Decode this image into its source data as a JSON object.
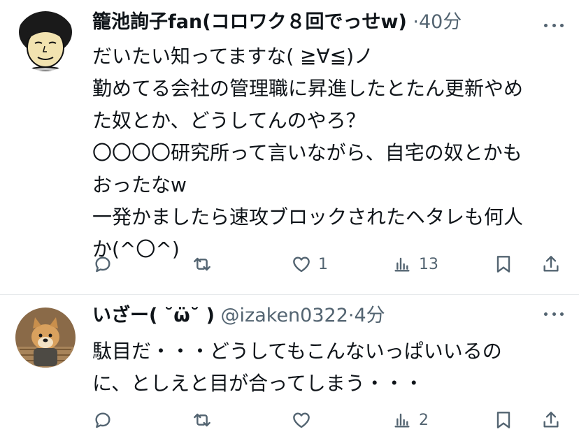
{
  "tweets": [
    {
      "author_name": "籠池詢子fan(コロワク８回でっせw)",
      "handle": "",
      "separator": "·",
      "time": "40分",
      "lines": [
        "だいたい知ってますな( ≧∀≦)ノ",
        "勤めてる会社の管理職に昇進したとたん更新やめ",
        "た奴とか、どうしてんのやろ？",
        "〇〇〇〇研究所って言いながら、自宅の奴とかも",
        "おったなw",
        "一発かましたら速攻ブロックされたヘタレも何人",
        "か(^〇^)"
      ],
      "counts": {
        "reply": "",
        "retweet": "",
        "like": "1",
        "views": "13"
      }
    },
    {
      "author_name": "いざー( ˘ω̈˘ )",
      "handle": "@izaken0322",
      "separator": "·",
      "time": "4分",
      "lines": [
        "駄目だ・・・どうしてもこんないっぱいいるの",
        "に、としえと目が合ってしまう・・・"
      ],
      "counts": {
        "reply": "",
        "retweet": "",
        "like": "",
        "views": "2"
      }
    }
  ],
  "icons": [
    "reply-icon",
    "retweet-icon",
    "like-icon",
    "views-icon",
    "bookmark-icon",
    "share-icon",
    "more-icon"
  ],
  "colors": {
    "text": "#0f1419",
    "secondary": "#536471",
    "divider": "#e6e9eb"
  }
}
